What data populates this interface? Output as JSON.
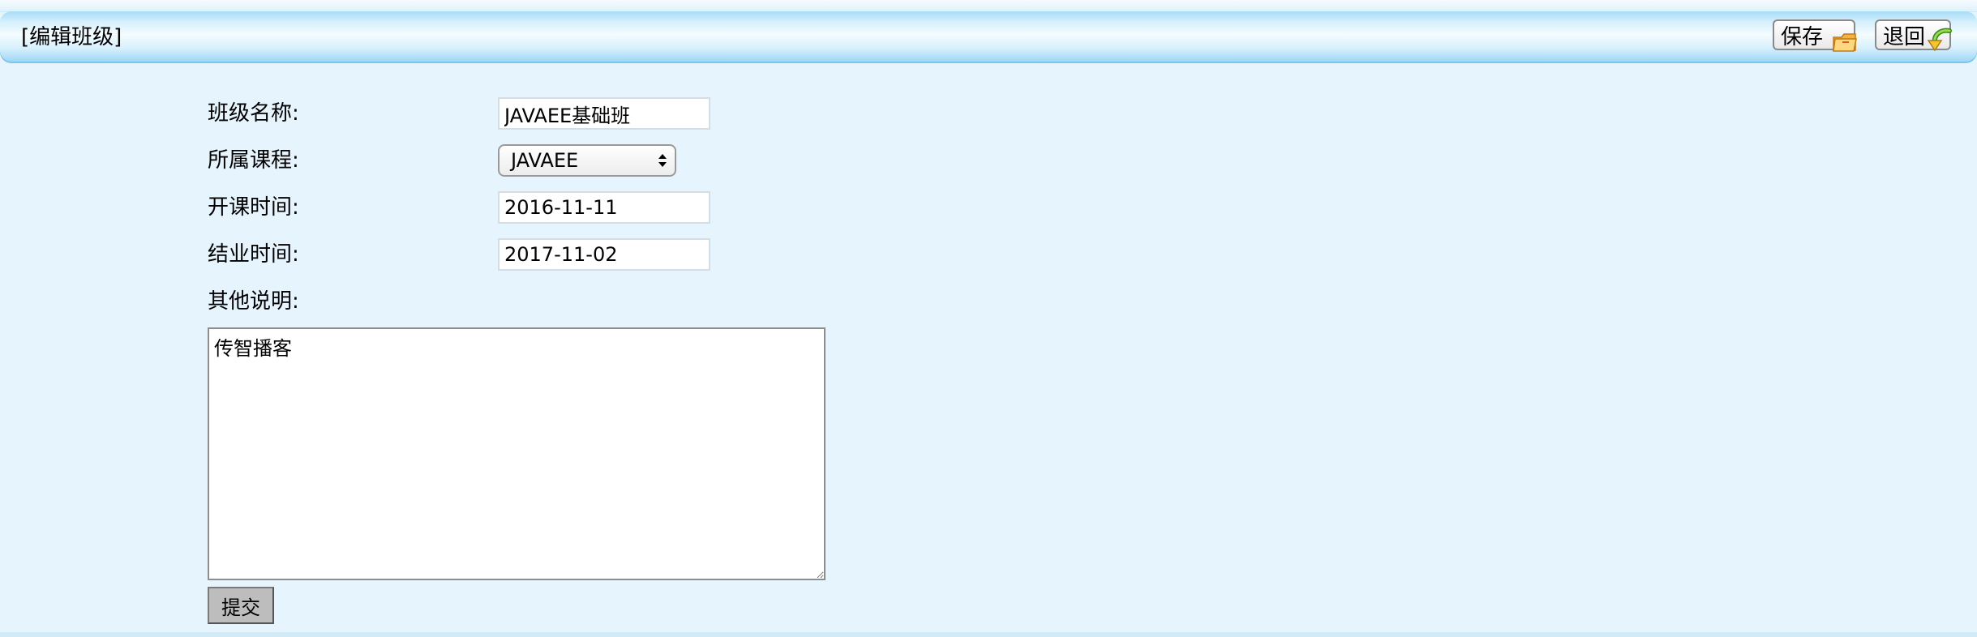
{
  "header": {
    "title": "[编辑班级]",
    "save_label": "保存",
    "back_label": "退回",
    "save_icon": "folder-icon",
    "back_icon": "return-arrow-icon"
  },
  "form": {
    "class_name_label": "班级名称:",
    "class_name_value": "JAVAEE基础班",
    "course_label": "所属课程:",
    "course_selected": "JAVAEE",
    "start_label": "开课时间:",
    "start_value": "2016-11-11",
    "end_label": "结业时间:",
    "end_value": "2017-11-02",
    "remark_label": "其他说明:",
    "remark_value": "传智播客",
    "submit_label": "提交"
  },
  "colors": {
    "page_background": "#e6f4fd",
    "header_gradient": "#a6dcf6"
  }
}
